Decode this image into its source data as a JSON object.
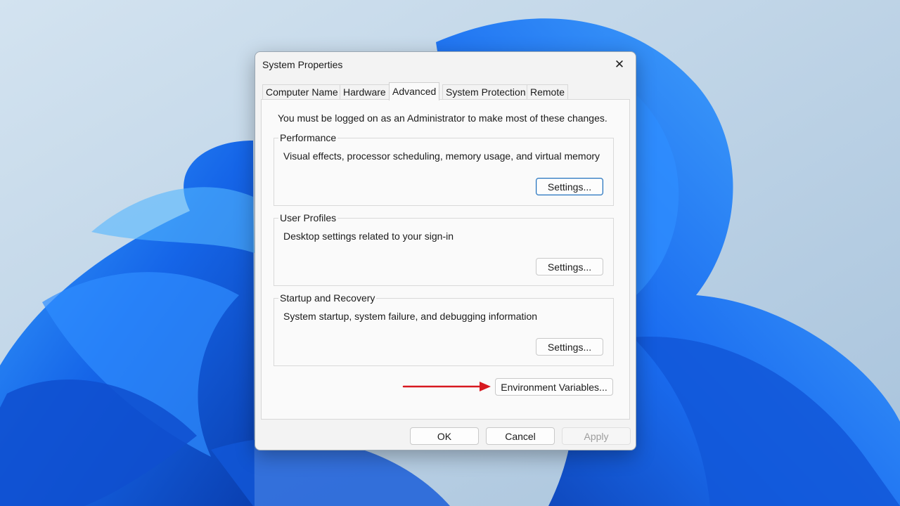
{
  "dialog": {
    "title": "System Properties",
    "close_symbol": "✕",
    "tabs": [
      {
        "label": "Computer Name",
        "active": false
      },
      {
        "label": "Hardware",
        "active": false
      },
      {
        "label": "Advanced",
        "active": true
      },
      {
        "label": "System Protection",
        "active": false
      },
      {
        "label": "Remote",
        "active": false
      }
    ],
    "notice": "You must be logged on as an Administrator to make most of these changes.",
    "groups": [
      {
        "title": "Performance",
        "description": "Visual effects, processor scheduling, memory usage, and virtual memory",
        "button": "Settings..."
      },
      {
        "title": "User Profiles",
        "description": "Desktop settings related to your sign-in",
        "button": "Settings..."
      },
      {
        "title": "Startup and Recovery",
        "description": "System startup, system failure, and debugging information",
        "button": "Settings..."
      }
    ],
    "env_button": "Environment Variables...",
    "footer": {
      "ok": "OK",
      "cancel": "Cancel",
      "apply": "Apply"
    }
  },
  "annotation": {
    "type": "red-arrow",
    "color": "#d71920",
    "points_to": "Environment Variables..."
  },
  "colors": {
    "accent": "#1a6dbc",
    "wallpaper_bg": "#b9d2e6",
    "wallpaper_bloom": "#1565e8",
    "annotation_red": "#d71920"
  }
}
